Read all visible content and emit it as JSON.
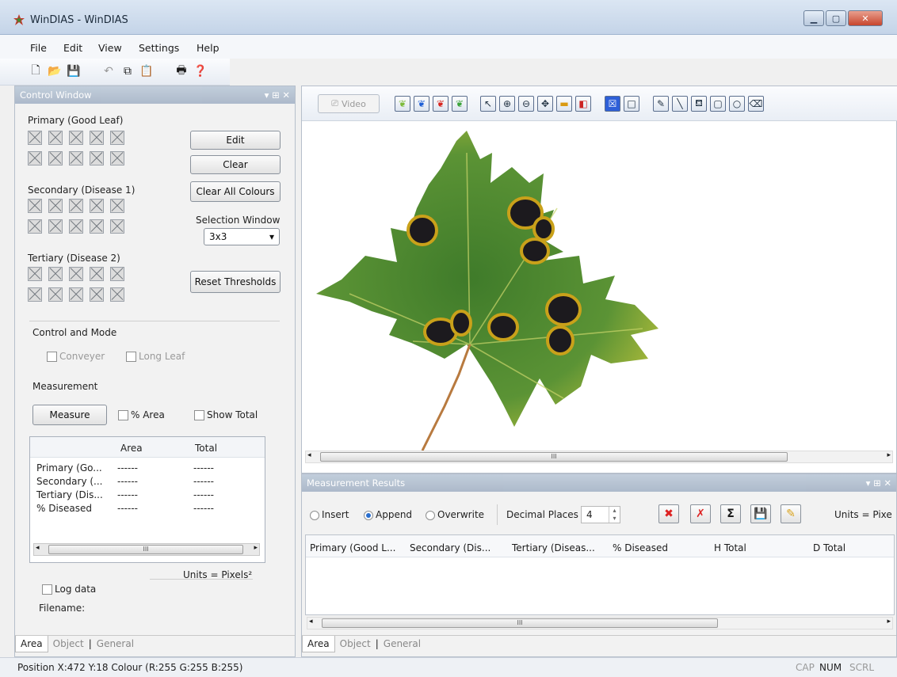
{
  "window": {
    "title": "WinDIAS - WinDIAS"
  },
  "menu": [
    "File",
    "Edit",
    "View",
    "Settings",
    "Help"
  ],
  "control": {
    "header": "Control Window",
    "primary_label": "Primary (Good Leaf)",
    "secondary_label": "Secondary (Disease 1)",
    "tertiary_label": "Tertiary (Disease 2)",
    "edit": "Edit",
    "clear": "Clear",
    "clear_all": "Clear All Colours",
    "selection_window_label": "Selection Window",
    "selection_window_value": "3x3",
    "reset": "Reset Thresholds",
    "control_mode_label": "Control and Mode",
    "conveyer": "Conveyer",
    "long_leaf": "Long Leaf",
    "measurement_label": "Measurement",
    "measure": "Measure",
    "pct_area": "% Area",
    "show_total": "Show Total",
    "table_headers": [
      "",
      "Area",
      "Total"
    ],
    "rows": [
      {
        "name": "Primary (Go...",
        "area": "------",
        "total": "------"
      },
      {
        "name": "Secondary (...",
        "area": "------",
        "total": "------"
      },
      {
        "name": "Tertiary (Dis...",
        "area": "------",
        "total": "------"
      },
      {
        "name": "% Diseased",
        "area": "------",
        "total": "------"
      }
    ],
    "units": "Units = Pixels²",
    "log_data": "Log data",
    "filename": "Filename:",
    "tabs": [
      "Area",
      "Object",
      "General"
    ]
  },
  "image_window": {
    "video_label": "Video"
  },
  "results": {
    "header": "Measurement Results",
    "insert": "Insert",
    "append": "Append",
    "overwrite": "Overwrite",
    "decimal_label": "Decimal Places",
    "decimal_value": "4",
    "units": "Units = Pixe",
    "columns": [
      "Primary (Good L...",
      "Secondary (Dis...",
      "Tertiary (Diseas...",
      "% Diseased",
      "H Total",
      "D Total"
    ],
    "tabs": [
      "Area",
      "Object",
      "General"
    ],
    "selected_mode": "Append"
  },
  "status": {
    "left": "Position  X:472 Y:18  Colour (R:255 G:255 B:255)",
    "cap": "CAP",
    "num": "NUM",
    "scrl": "SCRL"
  },
  "colors": {
    "leaf": "#4f8a2e",
    "lesion": "#1c1a1e",
    "halo": "#c9a11a",
    "panel_header": "#a9b7c9"
  }
}
